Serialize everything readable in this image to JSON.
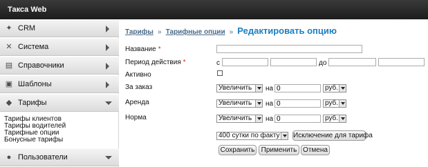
{
  "app": {
    "title": "Такса Web"
  },
  "sidebar": {
    "items": [
      {
        "label": "CRM",
        "icon": "handshake-icon"
      },
      {
        "label": "Система",
        "icon": "tools-icon"
      },
      {
        "label": "Справочники",
        "icon": "book-icon"
      },
      {
        "label": "Шаблоны",
        "icon": "folders-icon"
      },
      {
        "label": "Тарифы",
        "icon": "tag-icon"
      },
      {
        "label": "Пользователи",
        "icon": "users-icon"
      }
    ],
    "sub_items": [
      "Тарифы клиентов",
      "Тарифы водителей",
      "Тарифные опции",
      "Бонусные тарифы"
    ]
  },
  "breadcrumb": {
    "items": [
      "Тарифы",
      "Тарифные опции"
    ],
    "separator": "»",
    "current": "Редактировать опцию"
  },
  "form": {
    "name_label": "Название",
    "required_mark": "*",
    "name_value": "",
    "period_label": "Период действия",
    "from_label": "с",
    "to_label": "до",
    "active_label": "Активно",
    "rows": [
      {
        "label": "За заказ",
        "action": "Увеличить",
        "on_label": "на",
        "value": "0",
        "unit": "руб."
      },
      {
        "label": "Аренда",
        "action": "Увеличить",
        "on_label": "на",
        "value": "0",
        "unit": "руб."
      },
      {
        "label": "Норма",
        "action": "Увеличить",
        "on_label": "на",
        "value": "0",
        "unit": "руб."
      }
    ],
    "tariff_select": "400 сутки по факту",
    "exclude_button": "Исключение для тарифа",
    "save_button": "Сохранить",
    "apply_button": "Применить",
    "cancel_button": "Отмена"
  }
}
